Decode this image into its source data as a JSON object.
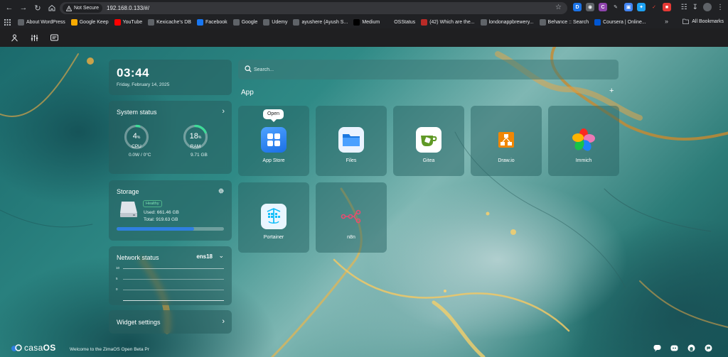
{
  "browser": {
    "secure_label": "Not Secure",
    "url": "192.168.0.133/#/",
    "bookmarks": [
      {
        "label": "About WordPress",
        "icon": "wordpress-icon",
        "color": "#5f6368"
      },
      {
        "label": "Google Keep",
        "icon": "google-keep-icon",
        "color": "#f9ab00"
      },
      {
        "label": "YouTube",
        "icon": "youtube-icon",
        "color": "#ff0000"
      },
      {
        "label": "Kexicache's DB",
        "icon": "bookmark-icon",
        "color": "#5f6368"
      },
      {
        "label": "Facebook",
        "icon": "facebook-icon",
        "color": "#1877f2"
      },
      {
        "label": "Google",
        "icon": "globe-icon",
        "color": "#5f6368"
      },
      {
        "label": "Udemy",
        "icon": "globe-icon",
        "color": "#5f6368"
      },
      {
        "label": "ayushere (Ayush S...",
        "icon": "github-icon",
        "color": "#5f6368"
      },
      {
        "label": "Medium",
        "icon": "medium-icon",
        "color": "#000000"
      },
      {
        "label": "OSStatus",
        "icon": "apple-icon",
        "color": "#202124"
      },
      {
        "label": "(42) Which are the...",
        "icon": "quora-icon",
        "color": "#b92b27"
      },
      {
        "label": "londonappbrewery...",
        "icon": "github-icon",
        "color": "#5f6368"
      },
      {
        "label": "Behance :: Search",
        "icon": "globe-icon",
        "color": "#5f6368"
      },
      {
        "label": "Coursera | Online...",
        "icon": "coursera-icon",
        "color": "#0056d2"
      }
    ],
    "all_bookmarks": "All Bookmarks"
  },
  "clock": {
    "time": "03:44",
    "date": "Friday, February 14, 2025"
  },
  "system_status": {
    "title": "System status",
    "cpu": {
      "value": "4",
      "unit": "%",
      "label": "CPU",
      "sub": "0.0W / 0°C",
      "percent": 4
    },
    "ram": {
      "value": "18",
      "unit": "%",
      "label": "RAM",
      "sub": "9.71 GB",
      "percent": 18
    }
  },
  "storage": {
    "title": "Storage",
    "status": "Healthy",
    "used": "Used: 661.46 GB",
    "total": "Total: 919.63 GB",
    "fraction": 0.72
  },
  "network": {
    "title": "Network status",
    "interface": "ens18",
    "ticks": [
      "10",
      "5",
      "0"
    ]
  },
  "widget_settings": "Widget settings",
  "search": {
    "placeholder": "Search..."
  },
  "apps_heading": "App",
  "tooltip": "Open",
  "apps": [
    {
      "name": "App Store",
      "icon": "app-store-icon"
    },
    {
      "name": "Files",
      "icon": "folder-icon"
    },
    {
      "name": "Gitea",
      "icon": "gitea-icon"
    },
    {
      "name": "Draw.io",
      "icon": "drawio-icon"
    },
    {
      "name": "Immich",
      "icon": "immich-icon"
    },
    {
      "name": "Portainer",
      "icon": "portainer-icon"
    },
    {
      "name": "n8n",
      "icon": "n8n-icon"
    }
  ],
  "footer": {
    "brand_a": "casa",
    "brand_b": "OS",
    "welcome": "Welcome to the ZimaOS Open Beta Pr"
  },
  "colors": {
    "accent_blue": "#2f7fe0",
    "gauge_green": "#3ddc97",
    "healthy_green": "#7fe3b5"
  }
}
